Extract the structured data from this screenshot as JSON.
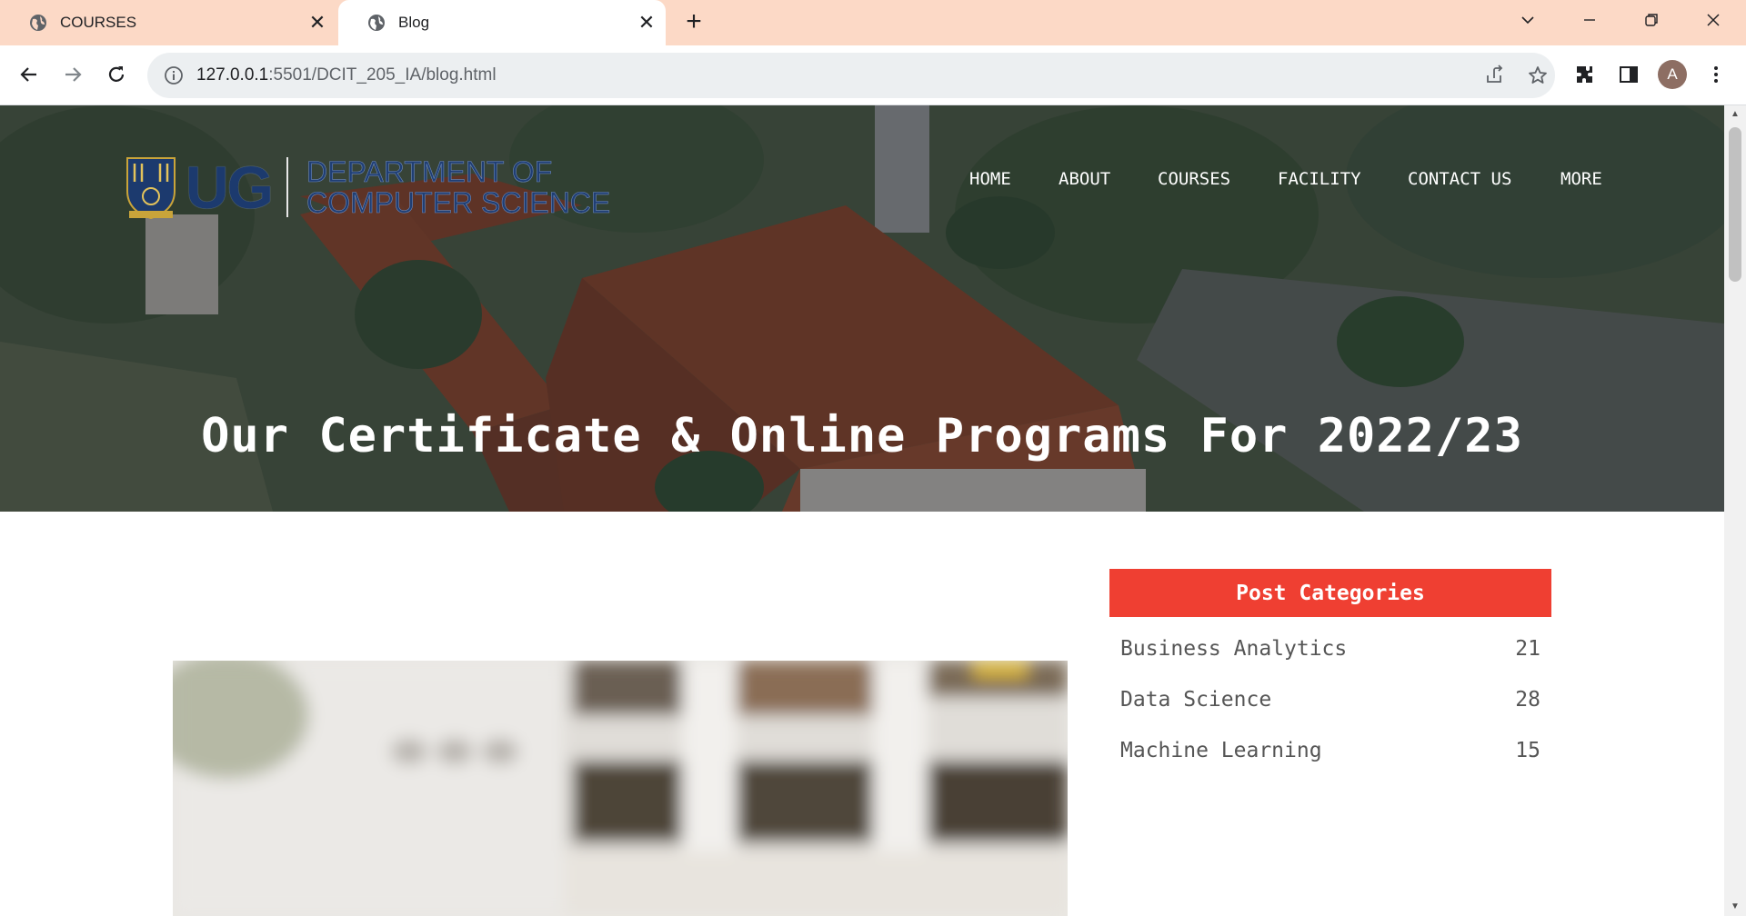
{
  "browser": {
    "tabs": [
      {
        "title": "COURSES",
        "active": false
      },
      {
        "title": "Blog",
        "active": true
      }
    ],
    "url_host": "127.0.0.1",
    "url_rest": ":5501/DCIT_205_IA/blog.html",
    "profile_initial": "A"
  },
  "header": {
    "logo_mark": "UG",
    "logo_line1": "DEPARTMENT OF",
    "logo_line2": "COMPUTER SCIENCE",
    "nav": [
      "HOME",
      "ABOUT",
      "COURSES",
      "FACILITY",
      "CONTACT US",
      "MORE"
    ]
  },
  "hero": {
    "title": "Our Certificate & Online Programs For 2022/23"
  },
  "sidebar": {
    "title": "Post Categories",
    "categories": [
      {
        "name": "Business Analytics",
        "count": "21"
      },
      {
        "name": "Data Science",
        "count": "28"
      },
      {
        "name": "Machine Learning",
        "count": "15"
      }
    ]
  },
  "colors": {
    "tabstrip": "#fcd9c6",
    "accent_red": "#ef3f32",
    "logo_blue": "#1f3e74"
  },
  "icons": [
    "globe-icon",
    "close-icon",
    "plus-icon",
    "chevron-down-icon",
    "minimize-icon",
    "restore-icon",
    "window-close-icon",
    "back-icon",
    "forward-icon",
    "reload-icon",
    "info-icon",
    "share-icon",
    "star-icon",
    "extensions-icon",
    "side-panel-icon",
    "menu-icon"
  ]
}
